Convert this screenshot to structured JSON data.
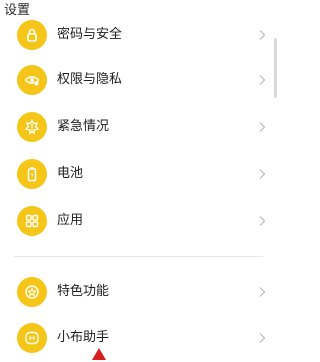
{
  "header": {
    "title": "设置"
  },
  "colors": {
    "accent": "#f5c518",
    "chevron": "#b9b9b9",
    "divider": "#e8e8e8",
    "cursor": "#d81e1e"
  },
  "items": [
    {
      "label": "密码与安全",
      "icon": "lock-icon"
    },
    {
      "label": "权限与隐私",
      "icon": "eye-privacy-icon"
    },
    {
      "label": "紧急情况",
      "icon": "emergency-icon"
    },
    {
      "label": "电池",
      "icon": "battery-icon"
    },
    {
      "label": "应用",
      "icon": "apps-grid-icon"
    },
    {
      "label": "特色功能",
      "icon": "star-icon"
    },
    {
      "label": "小布助手",
      "icon": "assistant-icon"
    }
  ]
}
